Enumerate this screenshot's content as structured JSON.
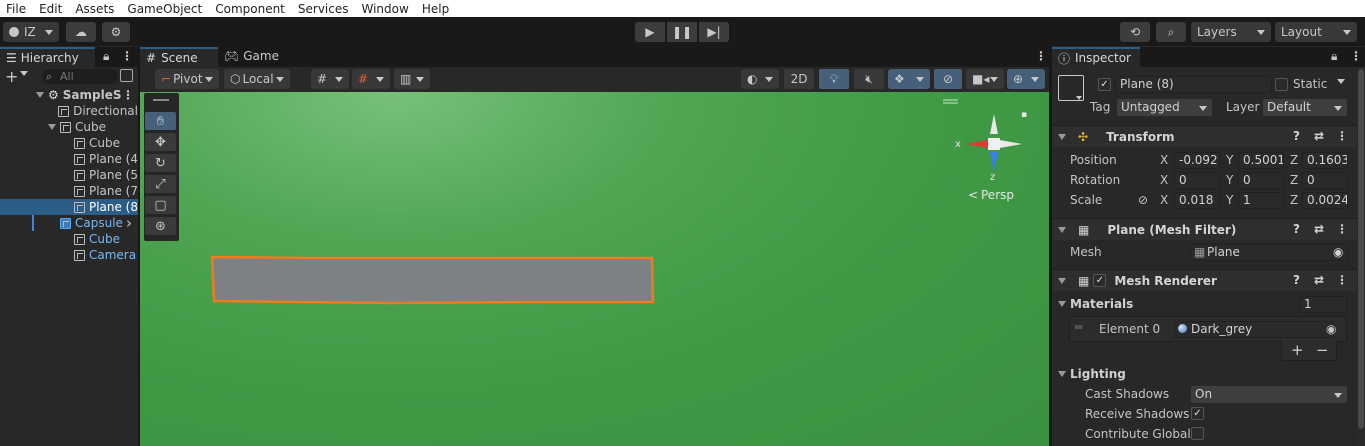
{
  "menu": [
    "File",
    "Edit",
    "Assets",
    "GameObject",
    "Component",
    "Services",
    "Window",
    "Help"
  ],
  "toolbar": {
    "account": "IZ",
    "layers": "Layers",
    "layout": "Layout"
  },
  "hierarchy": {
    "tab": "Hierarchy",
    "search_placeholder": "All",
    "items": [
      {
        "label": "SampleS",
        "indent": 0,
        "type": "scene"
      },
      {
        "label": "Directional",
        "indent": 1,
        "type": "obj"
      },
      {
        "label": "Cube",
        "indent": 1,
        "type": "obj",
        "expanded": true
      },
      {
        "label": "Cube",
        "indent": 2,
        "type": "obj"
      },
      {
        "label": "Plane (4",
        "indent": 2,
        "type": "obj"
      },
      {
        "label": "Plane (5",
        "indent": 2,
        "type": "obj"
      },
      {
        "label": "Plane (7",
        "indent": 2,
        "type": "obj"
      },
      {
        "label": "Plane (8",
        "indent": 2,
        "type": "obj",
        "selected": true
      },
      {
        "label": "Capsule",
        "indent": 1,
        "type": "prefab"
      },
      {
        "label": "Cube",
        "indent": 2,
        "type": "prefab-child"
      },
      {
        "label": "Camera",
        "indent": 2,
        "type": "prefab-child"
      }
    ]
  },
  "scene": {
    "tab_scene": "Scene",
    "tab_game": "Game",
    "pivot": "Pivot",
    "local": "Local",
    "mode_2d": "2D",
    "gizmo_x": "x",
    "gizmo_z": "z",
    "persp": "Persp"
  },
  "inspector": {
    "tab": "Inspector",
    "object_name": "Plane (8)",
    "static_label": "Static",
    "tag_label": "Tag",
    "tag_value": "Untagged",
    "layer_label": "Layer",
    "layer_value": "Default",
    "transform": {
      "title": "Transform",
      "position_label": "Position",
      "rotation_label": "Rotation",
      "scale_label": "Scale",
      "position": {
        "x": "-0.092",
        "y": "0.5001",
        "z": "0.1603"
      },
      "rotation": {
        "x": "0",
        "y": "0",
        "z": "0"
      },
      "scale": {
        "x": "0.018",
        "y": "1",
        "z": "0.0024"
      }
    },
    "mesh_filter": {
      "title": "Plane (Mesh Filter)",
      "mesh_label": "Mesh",
      "mesh_value": "Plane"
    },
    "mesh_renderer": {
      "title": "Mesh Renderer",
      "materials_label": "Materials",
      "materials_count": "1",
      "element_label": "Element 0",
      "element_value": "Dark_grey",
      "lighting_label": "Lighting",
      "cast_shadows_label": "Cast Shadows",
      "cast_shadows_value": "On",
      "receive_shadows_label": "Receive Shadows",
      "contribute_gi_label": "Contribute Global I"
    }
  },
  "colors": {
    "selection": "#2c5d87",
    "outline": "#f07b1d",
    "plane": "#808385",
    "scene_green": "#3f9945"
  }
}
